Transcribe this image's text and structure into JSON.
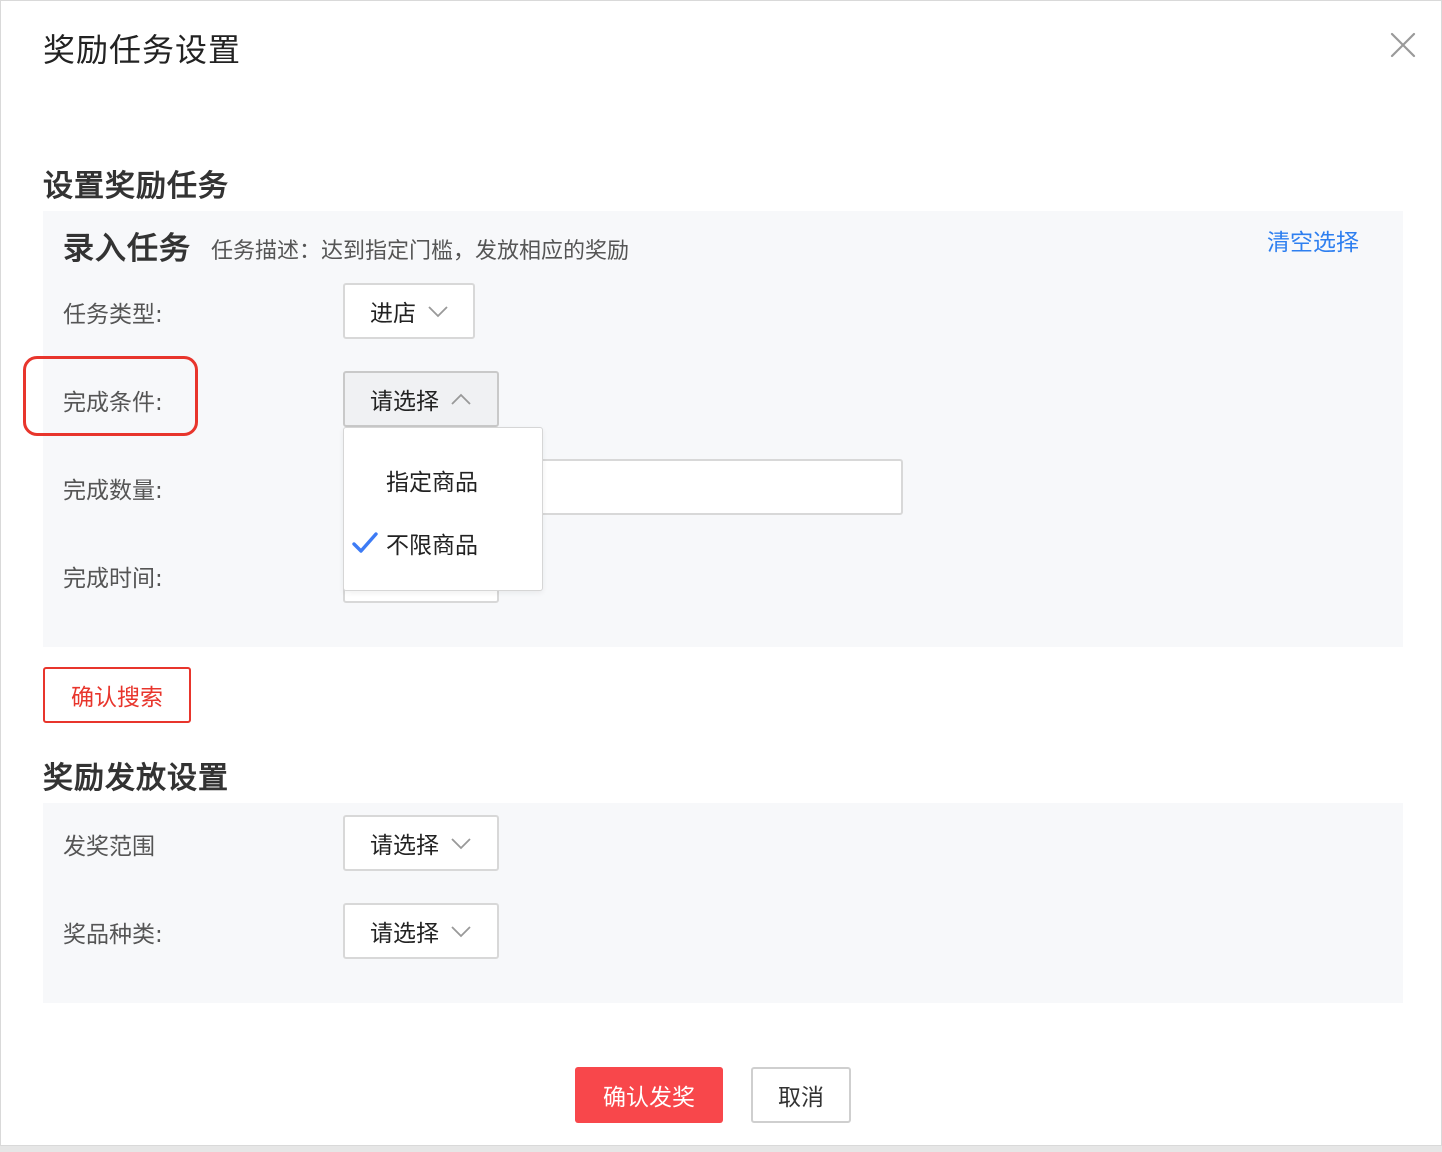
{
  "dialog": {
    "title": "奖励任务设置",
    "close_icon": "close-icon"
  },
  "task_section": {
    "title": "设置奖励任务",
    "panel_heading": "录入任务",
    "panel_description": "任务描述：达到指定门槛，发放相应的奖励",
    "clear_link": "清空选择",
    "fields": {
      "task_type": {
        "label": "任务类型:",
        "value": "进店"
      },
      "completion_condition": {
        "label": "完成条件:",
        "value": "请选择"
      },
      "completion_quantity": {
        "label": "完成数量:",
        "value": ""
      },
      "completion_time": {
        "label": "完成时间:"
      }
    },
    "condition_dropdown": {
      "options": [
        {
          "label": "指定商品",
          "selected": false
        },
        {
          "label": "不限商品",
          "selected": true
        }
      ]
    },
    "search_button": "确认搜索"
  },
  "reward_section": {
    "title": "奖励发放设置",
    "fields": {
      "award_scope": {
        "label": "发奖范围",
        "value": "请选择"
      },
      "prize_type": {
        "label": "奖品种类:",
        "value": "请选择"
      }
    }
  },
  "footer": {
    "confirm_button": "确认发奖",
    "cancel_button": "取消"
  },
  "colors": {
    "accent_red": "#f8474b",
    "link_blue": "#2e7ff0",
    "check_blue": "#3d7bf5",
    "highlight_red": "#e8352c",
    "panel_bg": "#f7f8fa"
  }
}
